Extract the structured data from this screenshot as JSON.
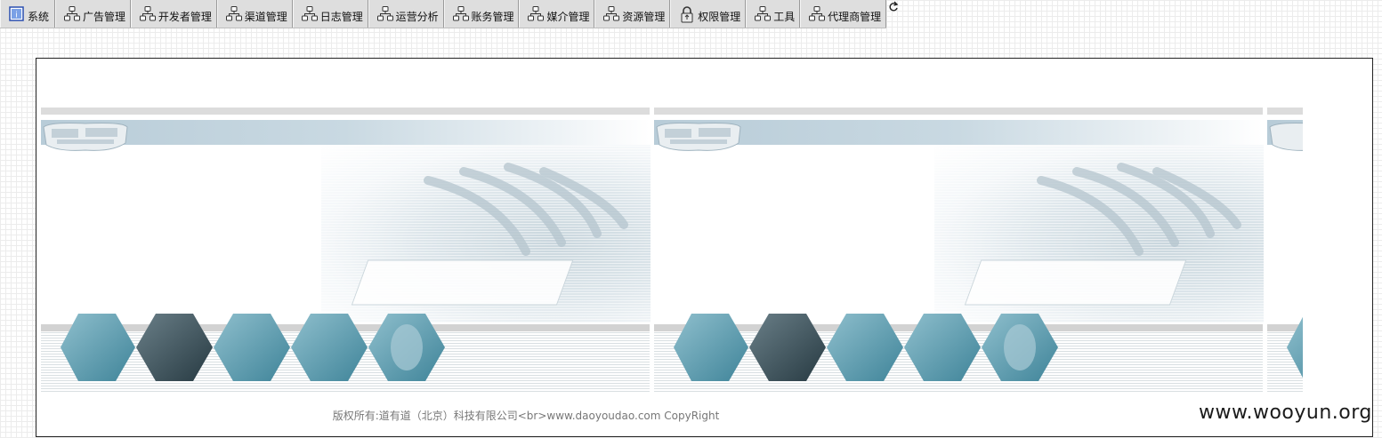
{
  "menu": {
    "items": [
      {
        "label": "系统",
        "icon": "system-icon"
      },
      {
        "label": "广告管理",
        "icon": "module-icon"
      },
      {
        "label": "开发者管理",
        "icon": "module-icon"
      },
      {
        "label": "渠道管理",
        "icon": "module-icon"
      },
      {
        "label": "日志管理",
        "icon": "module-icon"
      },
      {
        "label": "运营分析",
        "icon": "module-icon"
      },
      {
        "label": "账务管理",
        "icon": "module-icon"
      },
      {
        "label": "媒介管理",
        "icon": "module-icon"
      },
      {
        "label": "资源管理",
        "icon": "module-icon"
      },
      {
        "label": "权限管理",
        "icon": "lock-icon"
      },
      {
        "label": "工具",
        "icon": "module-icon"
      },
      {
        "label": "代理商管理",
        "icon": "module-icon"
      }
    ],
    "refresh_icon": "refresh-icon"
  },
  "footer": {
    "copyright": "版权所有:道有道（北京）科技有限公司<br>www.daoyoudao.com CopyRight"
  },
  "watermark": "www.wooyun.org",
  "colors": {
    "menubar": "#dedede",
    "banner_blue": "#6fa7b8",
    "frame_border": "#222222"
  }
}
